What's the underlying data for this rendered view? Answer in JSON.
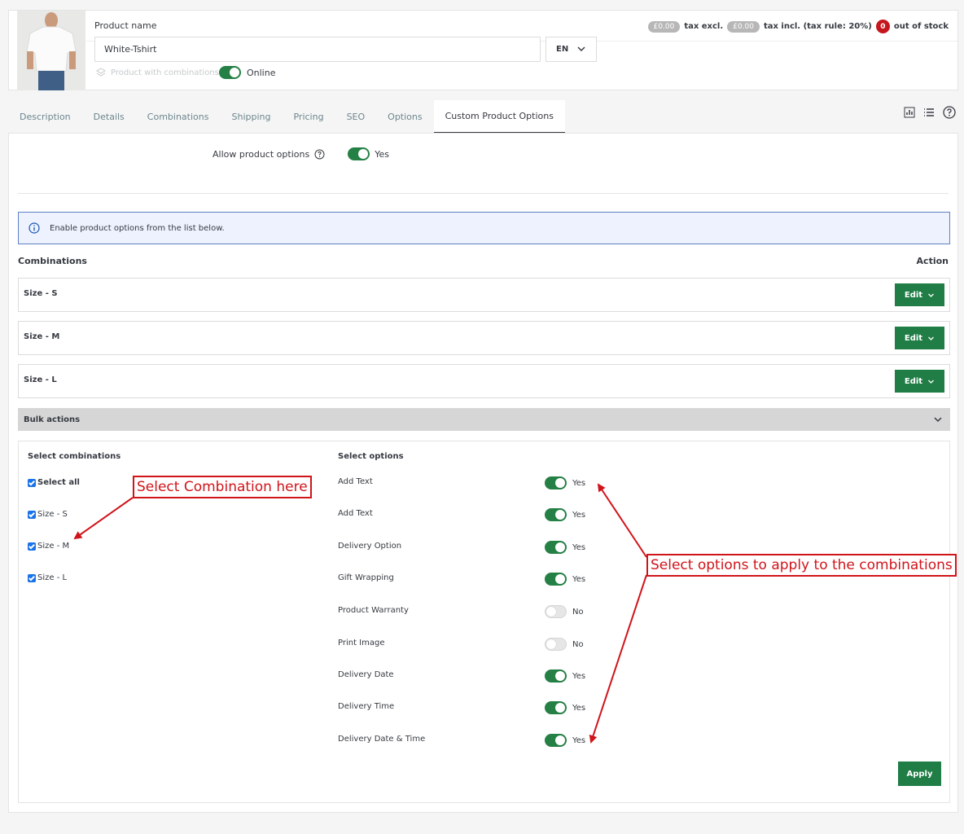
{
  "product": {
    "name_label": "Product name",
    "name_value": "White-Tshirt",
    "language": "EN",
    "combinations_label": "Product with combinations",
    "online_label": "Online"
  },
  "pricing": {
    "price_excl": "£0.00",
    "tax_excl_label": "tax excl.",
    "price_incl": "£0.00",
    "tax_incl_label": "tax incl. (tax rule: 20%)",
    "stock_count": "0",
    "stock_label": "out of stock"
  },
  "tabs": [
    {
      "label": "Description"
    },
    {
      "label": "Details"
    },
    {
      "label": "Combinations"
    },
    {
      "label": "Shipping"
    },
    {
      "label": "Pricing"
    },
    {
      "label": "SEO"
    },
    {
      "label": "Options"
    },
    {
      "label": "Custom Product Options",
      "active": true
    }
  ],
  "settings": {
    "allow_label": "Allow product options",
    "allow_value": "Yes",
    "info_text": "Enable product options from the list below."
  },
  "combinations": {
    "title": "Combinations",
    "action_title": "Action",
    "edit_label": "Edit",
    "rows": [
      {
        "name": "Size - S"
      },
      {
        "name": "Size - M"
      },
      {
        "name": "Size - L"
      }
    ]
  },
  "bulk": {
    "title": "Bulk actions",
    "select_combinations_title": "Select combinations",
    "select_options_title": "Select options",
    "select_all": "Select all",
    "combos": [
      "Size - S",
      "Size - M",
      "Size - L"
    ],
    "options": [
      {
        "label": "Add Text",
        "enabled": true,
        "state": "Yes"
      },
      {
        "label": "Add Text",
        "enabled": true,
        "state": "Yes"
      },
      {
        "label": "Delivery Option",
        "enabled": true,
        "state": "Yes"
      },
      {
        "label": "Gift Wrapping",
        "enabled": true,
        "state": "Yes"
      },
      {
        "label": "Product Warranty",
        "enabled": false,
        "state": "No"
      },
      {
        "label": "Print Image",
        "enabled": false,
        "state": "No"
      },
      {
        "label": "Delivery Date",
        "enabled": true,
        "state": "Yes"
      },
      {
        "label": "Delivery Time",
        "enabled": true,
        "state": "Yes"
      },
      {
        "label": "Delivery Date & Time",
        "enabled": true,
        "state": "Yes"
      }
    ],
    "apply_label": "Apply"
  },
  "annotations": {
    "combination_callout": "Select Combination here",
    "options_callout": "Select options to apply to the combinations"
  },
  "colors": {
    "primary_green": "#1f7d45",
    "toggle_green": "#258045",
    "annotation_red": "#d0141a",
    "info_blue": "#5d82c3",
    "stock_red": "#c4161c"
  }
}
